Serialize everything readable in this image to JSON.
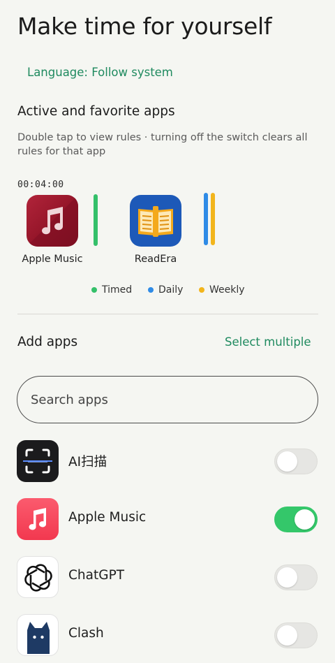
{
  "header": {
    "title": "Make time for yourself",
    "language_link": "Language: Follow system"
  },
  "favorites": {
    "section_title": "Active and favorite apps",
    "description": "Double tap to view rules · turning off the switch clears all rules for that app",
    "timer": "00:04:00",
    "apps": [
      {
        "name": "Apple Music",
        "icon": "apple-music-icon",
        "rules": [
          "Timed"
        ]
      },
      {
        "name": "ReadEra",
        "icon": "readera-book-icon",
        "rules": [
          "Daily",
          "Weekly"
        ]
      }
    ],
    "legend": [
      {
        "label": "Timed",
        "color": "#34c06a"
      },
      {
        "label": "Daily",
        "color": "#2f8be6"
      },
      {
        "label": "Weekly",
        "color": "#f2b51c"
      }
    ]
  },
  "add_apps": {
    "title": "Add apps",
    "select_multiple": "Select multiple",
    "search_placeholder": "Search apps",
    "apps": [
      {
        "name": "AI扫描",
        "icon": "ai-scan-icon",
        "enabled": false
      },
      {
        "name": "Apple Music",
        "icon": "apple-music-icon",
        "enabled": true
      },
      {
        "name": "ChatGPT",
        "icon": "chatgpt-icon",
        "enabled": false
      },
      {
        "name": "Clash",
        "icon": "clash-cat-icon",
        "enabled": false
      }
    ]
  },
  "colors": {
    "accent_green": "#1f8a5f",
    "toggle_on": "#34c76a",
    "background": "#f5f6f2"
  }
}
